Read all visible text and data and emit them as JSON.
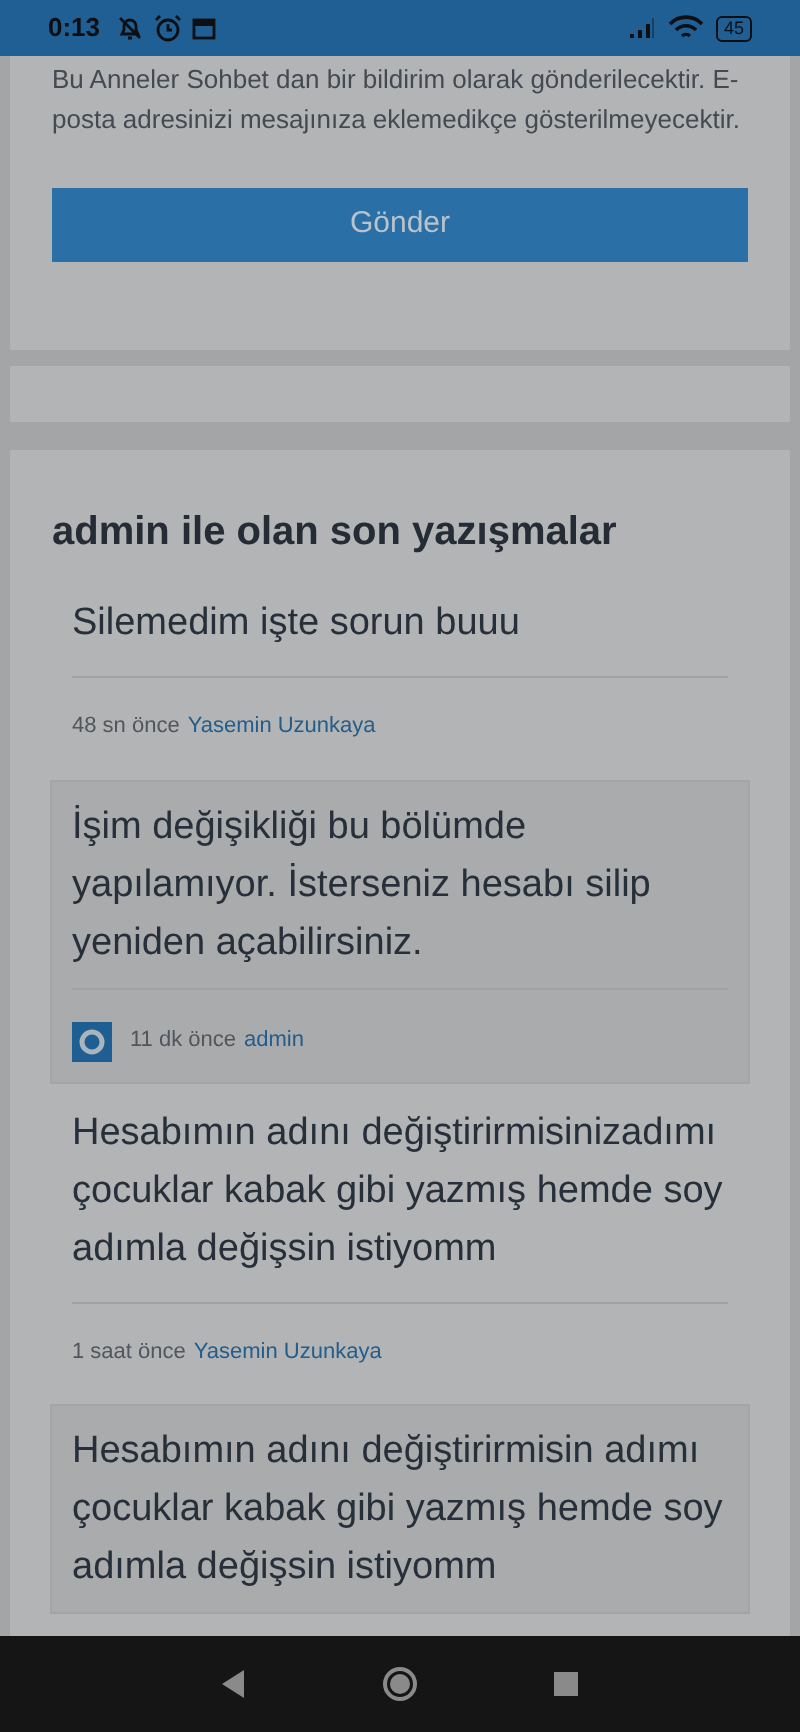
{
  "status_bar": {
    "time": "0:13",
    "battery": "45"
  },
  "notice": {
    "text": "Bu Anneler Sohbet dan bir bildirim olarak gönderilecektir. E-posta adresinizi mesajınıza eklemedikçe gösterilmeyecektir.",
    "button": "Gönder"
  },
  "conversation": {
    "title": "admin ile olan son yazışmalar",
    "messages": [
      {
        "kind": "received",
        "text": "Silemedim işte sorun buuu",
        "time": "48 sn önce",
        "author": "Yasemin Uzunkaya"
      },
      {
        "kind": "sent",
        "text": "İşim değişikliği bu bölümde yapılamıyor. İsterseniz hesabı silip yeniden açabilirsiniz.",
        "time": "11 dk önce",
        "author": "admin"
      },
      {
        "kind": "received",
        "text": "Hesabımın adını değiştirirmisinizadımı çocuklar kabak gibi yazmış hemde soy adımla değişsin istiyomm",
        "time": "1 saat önce",
        "author": "Yasemin Uzunkaya"
      },
      {
        "kind": "sent",
        "text": "Hesabımın adını değiştirirmisin adımı çocuklar kabak gibi yazmış hemde soy adımla değişsin istiyomm"
      }
    ]
  }
}
